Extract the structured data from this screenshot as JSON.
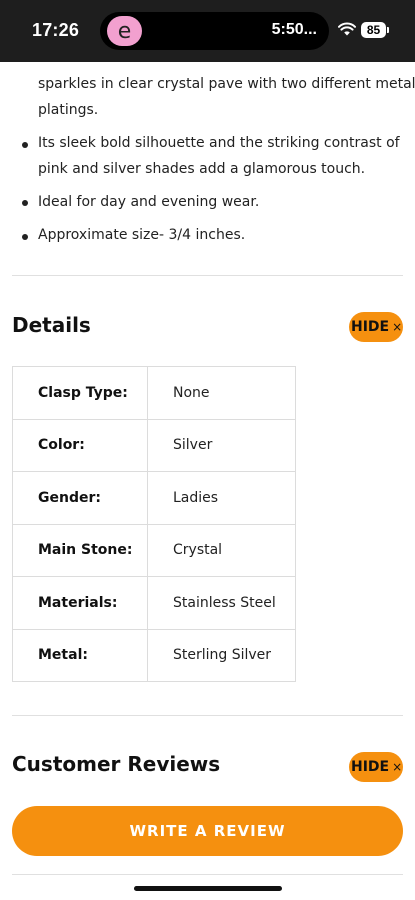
{
  "status_bar": {
    "time": "17:26",
    "island_text": "5:50...",
    "battery": "85",
    "app_badge_letter": "e",
    "app_badge_color": "#f2a0cf"
  },
  "description": {
    "lines": [
      "sparkles in clear crystal pave with two different metal",
      "platings.",
      "Its sleek bold silhouette and the striking contrast of",
      "pink and silver shades add a glamorous touch.",
      "Ideal for day and evening wear.",
      "Approximate size- 3/4 inches."
    ]
  },
  "details": {
    "title": "Details",
    "hide_label": "HIDE",
    "close_glyph": "×",
    "rows": [
      {
        "key": "Clasp Type:",
        "value": "None"
      },
      {
        "key": "Color:",
        "value": "Silver"
      },
      {
        "key": "Gender:",
        "value": "Ladies"
      },
      {
        "key": "Main Stone:",
        "value": "Crystal"
      },
      {
        "key": "Materials:",
        "value": "Stainless Steel"
      },
      {
        "key": "Metal:",
        "value": "Sterling Silver"
      }
    ]
  },
  "reviews": {
    "title": "Customer Reviews",
    "hide_label": "HIDE",
    "close_glyph": "×",
    "write_review_label": "WRITE A REVIEW"
  },
  "colors": {
    "accent": "#f5900f",
    "status_bar_bg": "#1e1e1e"
  }
}
